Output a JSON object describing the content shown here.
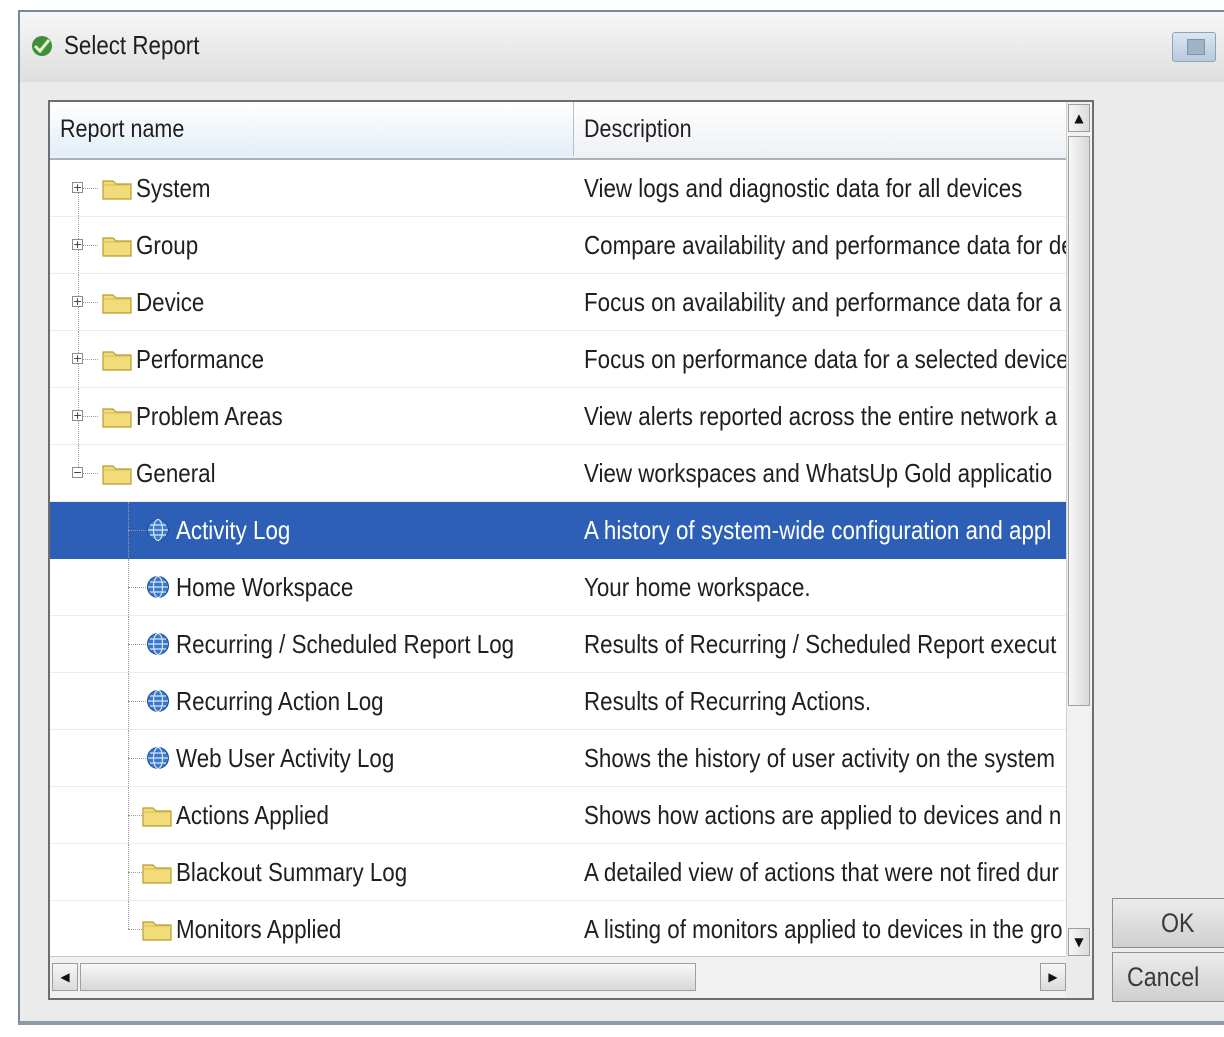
{
  "window": {
    "title": "Select Report"
  },
  "table": {
    "columns": {
      "name": "Report name",
      "description": "Description"
    },
    "rows": [
      {
        "name": "System",
        "description": "View logs and diagnostic data for all devices",
        "level": 0,
        "icon": "folder-icon",
        "expander": "+"
      },
      {
        "name": "Group",
        "description": "Compare availability and performance data for de",
        "level": 0,
        "icon": "folder-icon",
        "expander": "+"
      },
      {
        "name": "Device",
        "description": "Focus on availability and performance data for a",
        "level": 0,
        "icon": "folder-icon",
        "expander": "+"
      },
      {
        "name": "Performance",
        "description": "Focus on performance data for a selected device",
        "level": 0,
        "icon": "folder-icon",
        "expander": "+"
      },
      {
        "name": "Problem Areas",
        "description": "View alerts reported across the entire network a",
        "level": 0,
        "icon": "folder-icon",
        "expander": "+"
      },
      {
        "name": "General",
        "description": "View workspaces and WhatsUp Gold applicatio",
        "level": 0,
        "icon": "folder-icon",
        "expander": "−"
      },
      {
        "name": "Activity Log",
        "description": "A history of system-wide configuration and appl",
        "level": 1,
        "icon": "globe-icon",
        "selected": true
      },
      {
        "name": "Home Workspace",
        "description": "Your home workspace.",
        "level": 1,
        "icon": "globe-icon"
      },
      {
        "name": "Recurring / Scheduled Report Log",
        "description": "Results of Recurring / Scheduled Report execut",
        "level": 1,
        "icon": "globe-icon"
      },
      {
        "name": "Recurring Action Log",
        "description": "Results of Recurring Actions.",
        "level": 1,
        "icon": "globe-icon"
      },
      {
        "name": "Web User Activity Log",
        "description": "Shows the history of user activity on the system",
        "level": 1,
        "icon": "globe-icon"
      },
      {
        "name": "Actions Applied",
        "description": "Shows how actions are applied to devices and n",
        "level": 1,
        "icon": "folder-icon"
      },
      {
        "name": "Blackout Summary Log",
        "description": "A detailed view of actions that were not fired dur",
        "level": 1,
        "icon": "folder-icon"
      },
      {
        "name": "Monitors Applied",
        "description": "A listing of monitors applied to devices in the gro",
        "level": 1,
        "icon": "folder-icon"
      }
    ]
  },
  "buttons": {
    "ok": "OK",
    "cancel": "Cancel"
  },
  "colors": {
    "selection": "#2d5fb7",
    "folder": "#f2dc7a",
    "globe": "#3b78c9"
  }
}
